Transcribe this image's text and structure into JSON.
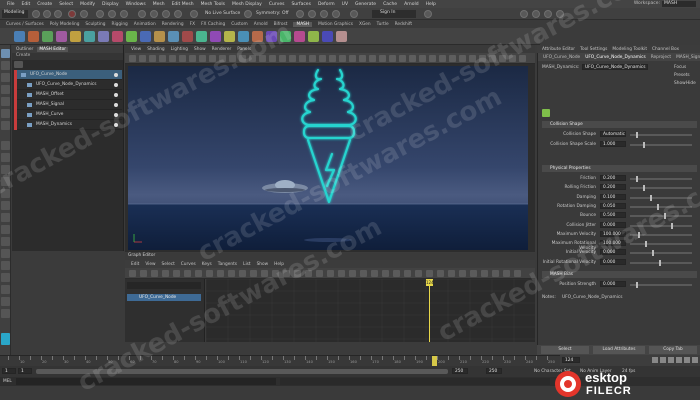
{
  "menubar": {
    "items": [
      "File",
      "Edit",
      "Create",
      "Select",
      "Modify",
      "Display",
      "Windows",
      "Mesh",
      "Edit Mesh",
      "Mesh Tools",
      "Mesh Display",
      "Curves",
      "Surfaces",
      "Deform",
      "UV",
      "Generate",
      "Cache",
      "Arnold",
      "Help"
    ],
    "workspace_label": "Workspace:",
    "workspace_value": "MASH"
  },
  "statusline": {
    "mode": "Modeling",
    "no_live_surface": "No Live Surface",
    "symmetry": "Symmetry: Off",
    "sign_in": "Sign In"
  },
  "shelf": {
    "tabs": [
      "Curves / Surfaces",
      "Poly Modeling",
      "Sculpting",
      "Rigging",
      "Animation",
      "Rendering",
      "FX",
      "FX Caching",
      "Custom",
      "Arnold",
      "Bifrost",
      "MASH",
      "Motion Graphics",
      "XGen",
      "Turtle",
      "Redshift"
    ],
    "active_tab": "MASH"
  },
  "outliner": {
    "tabs": [
      "Outliner",
      "MASH Editor"
    ],
    "subbar": "Create",
    "items": [
      {
        "label": "UFO_Curve_Node",
        "selected": true,
        "child": false
      },
      {
        "label": "UFO_Curve_Node_Dynamics",
        "selected": false,
        "child": true
      },
      {
        "label": "MASH_Offset",
        "selected": false,
        "child": true
      },
      {
        "label": "MASH_Signal",
        "selected": false,
        "child": true
      },
      {
        "label": "MASH_Curve",
        "selected": false,
        "child": true
      },
      {
        "label": "MASH_Dynamics",
        "selected": false,
        "child": true
      }
    ]
  },
  "viewport": {
    "menu": [
      "View",
      "Shading",
      "Lighting",
      "Show",
      "Renderer",
      "Panels"
    ]
  },
  "graph_editor": {
    "title": "Graph Editor",
    "menu": [
      "Edit",
      "View",
      "Select",
      "Curves",
      "Keys",
      "Tangents",
      "List",
      "Show",
      "Help"
    ],
    "selected_node": "UFO_Curve_Node",
    "current_frame": "124"
  },
  "attribute_editor": {
    "tabs": [
      "Attribute Editor",
      "Tool Settings",
      "Modeling Toolkit",
      "Channel Box"
    ],
    "node_tabs": [
      "UFO_Curve_Node",
      "UFO_Curve_Node_Dynamics",
      "Reproject",
      "MASH_Signal"
    ],
    "node_label": "MASH_Dynamics:",
    "node_value": "UFO_Curve_Node_Dynamics",
    "focus": "Focus",
    "presets": "Presets",
    "show": "Show",
    "hide": "Hide",
    "sections": [
      {
        "title": "Collision Shape"
      },
      {
        "title": "Physical Properties"
      },
      {
        "title": "MASH Bias"
      }
    ],
    "collision": [
      {
        "label": "Collision Shape",
        "value": "Automatic"
      },
      {
        "label": "Collision Shape Scale",
        "value": "1.000"
      }
    ],
    "physical": [
      {
        "label": "Friction",
        "value": "0.200"
      },
      {
        "label": "Rolling Friction",
        "value": "0.200"
      },
      {
        "label": "Damping",
        "value": "0.100"
      },
      {
        "label": "Rotation Damping",
        "value": "0.050"
      },
      {
        "label": "Bounce",
        "value": "0.500"
      },
      {
        "label": "Collision Jitter",
        "value": "0.000"
      },
      {
        "label": "Maximum Velocity",
        "value": "100.000"
      },
      {
        "label": "Maximum Rotational Velocity",
        "value": "100.000"
      },
      {
        "label": "Initial Velocity",
        "value": "0.000"
      },
      {
        "label": "Initial Rotational Velocity",
        "value": "0.000"
      }
    ],
    "bias": [
      {
        "label": "Position Strength",
        "value": "0.000"
      }
    ],
    "notes_label": "Notes:",
    "notes_value": "UFO_Curve_Node_Dynamics",
    "buttons": [
      "Select",
      "Load Attributes",
      "Copy Tab"
    ]
  },
  "time": {
    "range_start": "1",
    "range_end": "250",
    "playback_start": "1",
    "playback_end": "250",
    "current": "124",
    "fps": "24 fps",
    "no_character_set": "No Character Set",
    "no_anim_layer": "No Anim Layer",
    "ticks": [
      "5",
      "10",
      "15",
      "20",
      "25",
      "30",
      "35",
      "40",
      "45",
      "50",
      "55",
      "60",
      "65",
      "70",
      "75",
      "80",
      "85",
      "90",
      "95",
      "100",
      "105",
      "110",
      "115",
      "120",
      "125",
      "130",
      "135",
      "140",
      "145",
      "150",
      "155",
      "160",
      "165",
      "170",
      "175",
      "180",
      "185",
      "190",
      "195",
      "200",
      "205",
      "210",
      "215",
      "220",
      "225",
      "230",
      "235",
      "240",
      "245",
      "250"
    ]
  },
  "cmdline": {
    "mel": "MEL"
  },
  "watermark": "cracked-softwares.com",
  "brand": {
    "line1": "esktop",
    "line2": "FILECR",
    "accent": "#e3352b"
  },
  "colors": {
    "selection": "#3b5f7c",
    "neon": "#27d4cf",
    "timeline_marker": "#e8d84a",
    "outliner_tag": "#c83c3c"
  }
}
